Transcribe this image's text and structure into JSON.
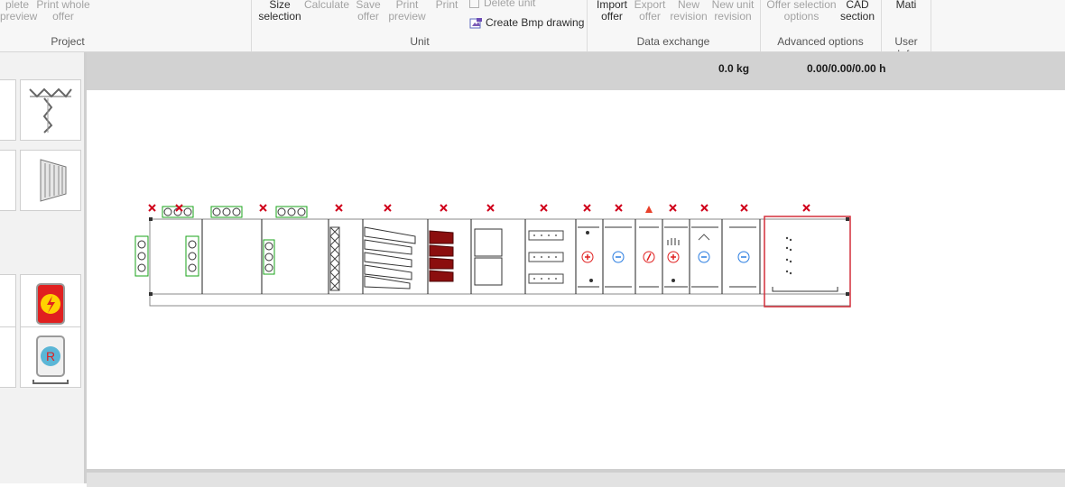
{
  "ribbon": {
    "groups": [
      {
        "label": "Project"
      },
      {
        "label": "Unit"
      },
      {
        "label": "Data exchange"
      },
      {
        "label": "Advanced options"
      },
      {
        "label": "User Info"
      }
    ],
    "buttons": {
      "complete_preview": {
        "line1": "plete",
        "line2": "preview"
      },
      "print_whole_offer": {
        "line1": "Print whole",
        "line2": "offer"
      },
      "size_selection": {
        "line1": "Size",
        "line2": "selection"
      },
      "calculate": {
        "line1": "Calculate"
      },
      "save_offer": {
        "line1": "Save",
        "line2": "offer"
      },
      "print_preview": {
        "line1": "Print",
        "line2": "preview"
      },
      "print": {
        "line1": "Print"
      },
      "delete_unit": {
        "line1": "Delete unit"
      },
      "create_bmp": {
        "line1": "Create Bmp drawing"
      },
      "import_offer": {
        "line1": "Import",
        "line2": "offer"
      },
      "export_offer": {
        "line1": "Export",
        "line2": "offer"
      },
      "new_revision": {
        "line1": "New",
        "line2": "revision"
      },
      "new_unit_revision": {
        "line1": "New unit",
        "line2": "revision"
      },
      "offer_selection_options": {
        "line1": "Offer selection",
        "line2": "options"
      },
      "cad_section": {
        "line1": "CAD",
        "line2": "section"
      },
      "user": {
        "line1": "Mati"
      }
    }
  },
  "infobar": {
    "weight": "0.0 kg",
    "hours": "0.00/0.00/0.00 h"
  },
  "palette": {
    "tiles": [
      {
        "icon": "damper-mixing-icon"
      },
      {
        "icon": "silencer-icon"
      },
      {
        "icon": "electric-heater-icon"
      },
      {
        "icon": "rotary-exchanger-icon"
      }
    ]
  },
  "unit_drawing": {
    "sections": [
      {
        "name": "inlet-damper-section"
      },
      {
        "name": "mixing-box-section"
      },
      {
        "name": "damper-section"
      },
      {
        "name": "panel-filter-section"
      },
      {
        "name": "bag-filter-section"
      },
      {
        "name": "bag-filter-section-2"
      },
      {
        "name": "empty-section"
      },
      {
        "name": "carbon-filter-section"
      },
      {
        "name": "heater-section"
      },
      {
        "name": "cooler-section"
      },
      {
        "name": "electric-heater-section"
      },
      {
        "name": "humidifier-heater-section"
      },
      {
        "name": "steam-humidifier-section"
      },
      {
        "name": "cooler-section-2"
      },
      {
        "name": "fan-section"
      }
    ],
    "colors": {
      "delete_marker": "#d0021b",
      "warning_marker": "#e8402a",
      "damper": "#1aa31a",
      "bag_filter": "#8b0e0e",
      "heater": "#e02020",
      "cooler": "#2a7de1",
      "selection": "#d32f3a"
    }
  }
}
